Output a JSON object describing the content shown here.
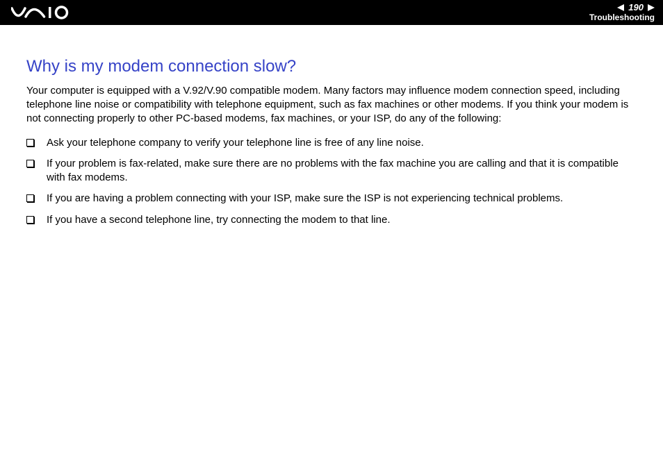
{
  "header": {
    "page_number": "190",
    "section": "Troubleshooting"
  },
  "content": {
    "heading": "Why is my modem connection slow?",
    "intro": "Your computer is equipped with a V.92/V.90 compatible modem. Many factors may influence modem connection speed, including telephone line noise or compatibility with telephone equipment, such as fax machines or other modems. If you think your modem is not connecting properly to other PC-based modems, fax machines, or your ISP, do any of the following:",
    "bullets": [
      "Ask your telephone company to verify your telephone line is free of any line noise.",
      "If your problem is fax-related, make sure there are no problems with the fax machine you are calling and that it is compatible with fax modems.",
      "If you are having a problem connecting with your ISP, make sure the ISP is not experiencing technical problems.",
      "If you have a second telephone line, try connecting the modem to that line."
    ]
  }
}
